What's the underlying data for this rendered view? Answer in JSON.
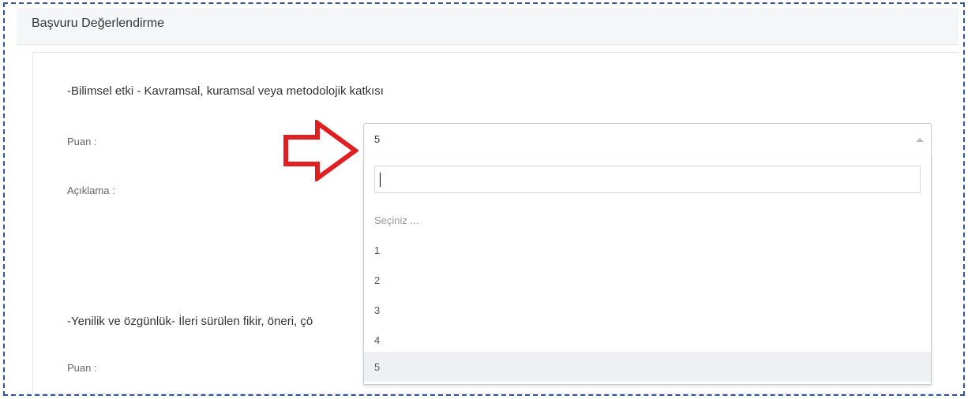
{
  "panel": {
    "title": "Başvuru Değerlendirme"
  },
  "section1": {
    "title": "-Bilimsel etki - Kavramsal, kuramsal veya metodolojik katkısı",
    "score_label": "Puan :",
    "description_label": "Açıklama :",
    "score_value": "5"
  },
  "section2": {
    "title": "-Yenilik ve özgünlük- İleri sürülen fikir, öneri, çö",
    "score_label": "Puan :"
  },
  "dropdown": {
    "search_value": "",
    "options": [
      "Seçiniz ...",
      "1",
      "2",
      "3",
      "4",
      "5"
    ],
    "selected": "5"
  },
  "colors": {
    "frame_border": "#2f5597",
    "arrow": "#e02020",
    "selected_option_bg": "#eef0f3"
  },
  "icons": [
    "caret-up-icon",
    "red-arrow-icon"
  ]
}
